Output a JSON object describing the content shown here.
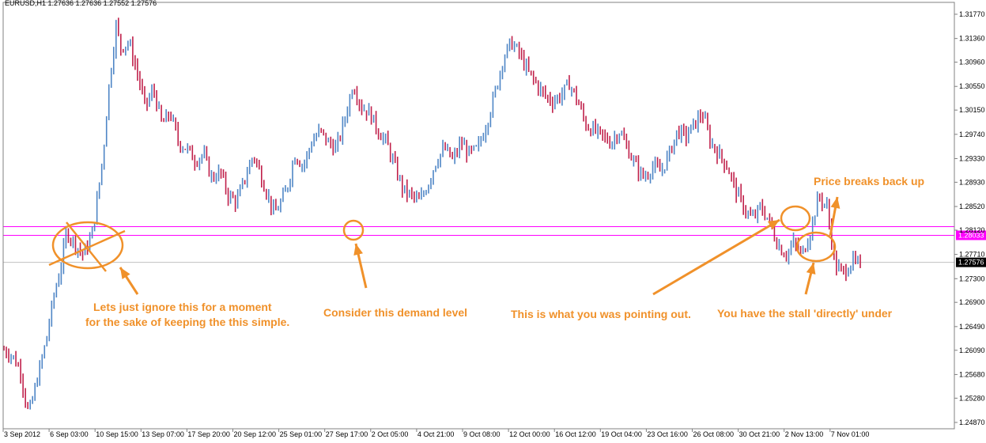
{
  "chart_data": {
    "type": "candlestick",
    "symbol_header": "EURUSD,H1  1.27636 1.27636 1.27552 1.27576",
    "ylim": [
      1.2487,
      1.3177
    ],
    "y_ticks": [
      "1.31770",
      "1.31360",
      "1.30960",
      "1.30550",
      "1.30150",
      "1.29740",
      "1.29330",
      "1.28930",
      "1.28520",
      "1.28120",
      "1.27710",
      "1.27300",
      "1.26900",
      "1.26490",
      "1.26090",
      "1.25680",
      "1.25280",
      "1.24870"
    ],
    "x_ticks": [
      "3 Sep 2012",
      "6 Sep 03:00",
      "10 Sep 15:00",
      "13 Sep 07:00",
      "17 Sep 20:00",
      "20 Sep 12:00",
      "25 Sep 01:00",
      "27 Sep 17:00",
      "2 Oct 05:00",
      "4 Oct 21:00",
      "9 Oct 08:00",
      "12 Oct 00:00",
      "16 Oct 12:00",
      "19 Oct 04:00",
      "23 Oct 16:00",
      "26 Oct 08:00",
      "30 Oct 21:00",
      "2 Nov 13:00",
      "7 Nov 01:00"
    ],
    "price_path": [
      [
        0,
        1.261
      ],
      [
        2,
        1.26
      ],
      [
        4,
        1.2575
      ],
      [
        5,
        1.253
      ],
      [
        6,
        1.25
      ],
      [
        8,
        1.256
      ],
      [
        10,
        1.262
      ],
      [
        12,
        1.27
      ],
      [
        14,
        1.276
      ],
      [
        15,
        1.281
      ],
      [
        17,
        1.279
      ],
      [
        19,
        1.277
      ],
      [
        21,
        1.28
      ],
      [
        22,
        1.284
      ],
      [
        24,
        1.295
      ],
      [
        25,
        1.304
      ],
      [
        26,
        1.31
      ],
      [
        27,
        1.316
      ],
      [
        28,
        1.312
      ],
      [
        30,
        1.313
      ],
      [
        32,
        1.308
      ],
      [
        34,
        1.302
      ],
      [
        36,
        1.305
      ],
      [
        38,
        1.299
      ],
      [
        40,
        1.301
      ],
      [
        42,
        1.296
      ],
      [
        44,
        1.295
      ],
      [
        46,
        1.293
      ],
      [
        48,
        1.294
      ],
      [
        50,
        1.29
      ],
      [
        52,
        1.291
      ],
      [
        54,
        1.287
      ],
      [
        56,
        1.286
      ],
      [
        58,
        1.29
      ],
      [
        60,
        1.294
      ],
      [
        62,
        1.29
      ],
      [
        64,
        1.286
      ],
      [
        65,
        1.284
      ],
      [
        66,
        1.285
      ],
      [
        68,
        1.288
      ],
      [
        70,
        1.294
      ],
      [
        72,
        1.292
      ],
      [
        74,
        1.296
      ],
      [
        76,
        1.298
      ],
      [
        78,
        1.296
      ],
      [
        80,
        1.295
      ],
      [
        82,
        1.3
      ],
      [
        84,
        1.306
      ],
      [
        86,
        1.302
      ],
      [
        88,
        1.301
      ],
      [
        90,
        1.298
      ],
      [
        92,
        1.296
      ],
      [
        94,
        1.292
      ],
      [
        96,
        1.288
      ],
      [
        98,
        1.287
      ],
      [
        100,
        1.286
      ],
      [
        102,
        1.289
      ],
      [
        104,
        1.293
      ],
      [
        106,
        1.295
      ],
      [
        108,
        1.293
      ],
      [
        110,
        1.296
      ],
      [
        112,
        1.294
      ],
      [
        114,
        1.295
      ],
      [
        116,
        1.299
      ],
      [
        118,
        1.304
      ],
      [
        120,
        1.31
      ],
      [
        122,
        1.313
      ],
      [
        124,
        1.311
      ],
      [
        126,
        1.308
      ],
      [
        128,
        1.306
      ],
      [
        130,
        1.304
      ],
      [
        132,
        1.303
      ],
      [
        134,
        1.304
      ],
      [
        136,
        1.306
      ],
      [
        138,
        1.303
      ],
      [
        140,
        1.299
      ],
      [
        142,
        1.298
      ],
      [
        144,
        1.297
      ],
      [
        146,
        1.296
      ],
      [
        148,
        1.298
      ],
      [
        150,
        1.295
      ],
      [
        152,
        1.292
      ],
      [
        154,
        1.29
      ],
      [
        156,
        1.292
      ],
      [
        158,
        1.291
      ],
      [
        160,
        1.294
      ],
      [
        162,
        1.298
      ],
      [
        164,
        1.297
      ],
      [
        166,
        1.299
      ],
      [
        168,
        1.301
      ],
      [
        170,
        1.296
      ],
      [
        172,
        1.294
      ],
      [
        174,
        1.292
      ],
      [
        176,
        1.288
      ],
      [
        178,
        1.285
      ],
      [
        180,
        1.283
      ],
      [
        182,
        1.285
      ],
      [
        184,
        1.283
      ],
      [
        186,
        1.279
      ],
      [
        188,
        1.277
      ],
      [
        190,
        1.279
      ],
      [
        192,
        1.277
      ],
      [
        194,
        1.281
      ],
      [
        196,
        1.287
      ],
      [
        198,
        1.285
      ],
      [
        199,
        1.28
      ],
      [
        200,
        1.275
      ],
      [
        202,
        1.274
      ],
      [
        204,
        1.276
      ],
      [
        206,
        1.275
      ]
    ],
    "horizontal_lines": [
      {
        "value": 1.2818,
        "color": "#ff00ff",
        "label": ""
      },
      {
        "value": 1.28033,
        "color": "#ff00ff",
        "label": "1.28033"
      },
      {
        "value": 1.27576,
        "color": "#c0c0c0",
        "label": "1.27576"
      }
    ],
    "annotations": [
      {
        "text": "Lets just ignore this for a moment",
        "id": "ignore-1"
      },
      {
        "text": "for the sake of keeping the this simple.",
        "id": "ignore-2"
      },
      {
        "text": "Consider this demand level",
        "id": "demand"
      },
      {
        "text": "This is what you was pointing out.",
        "id": "pointing"
      },
      {
        "text": "You have the stall 'directly' under",
        "id": "stall"
      },
      {
        "text": "Price breaks back up",
        "id": "breaks"
      }
    ],
    "colors": {
      "bull": "#4f86c6",
      "bear": "#c0204a",
      "annotation": "#f0912a",
      "level": "#ff00ff",
      "bid": "#c0c0c0",
      "axis": "#808080"
    }
  }
}
